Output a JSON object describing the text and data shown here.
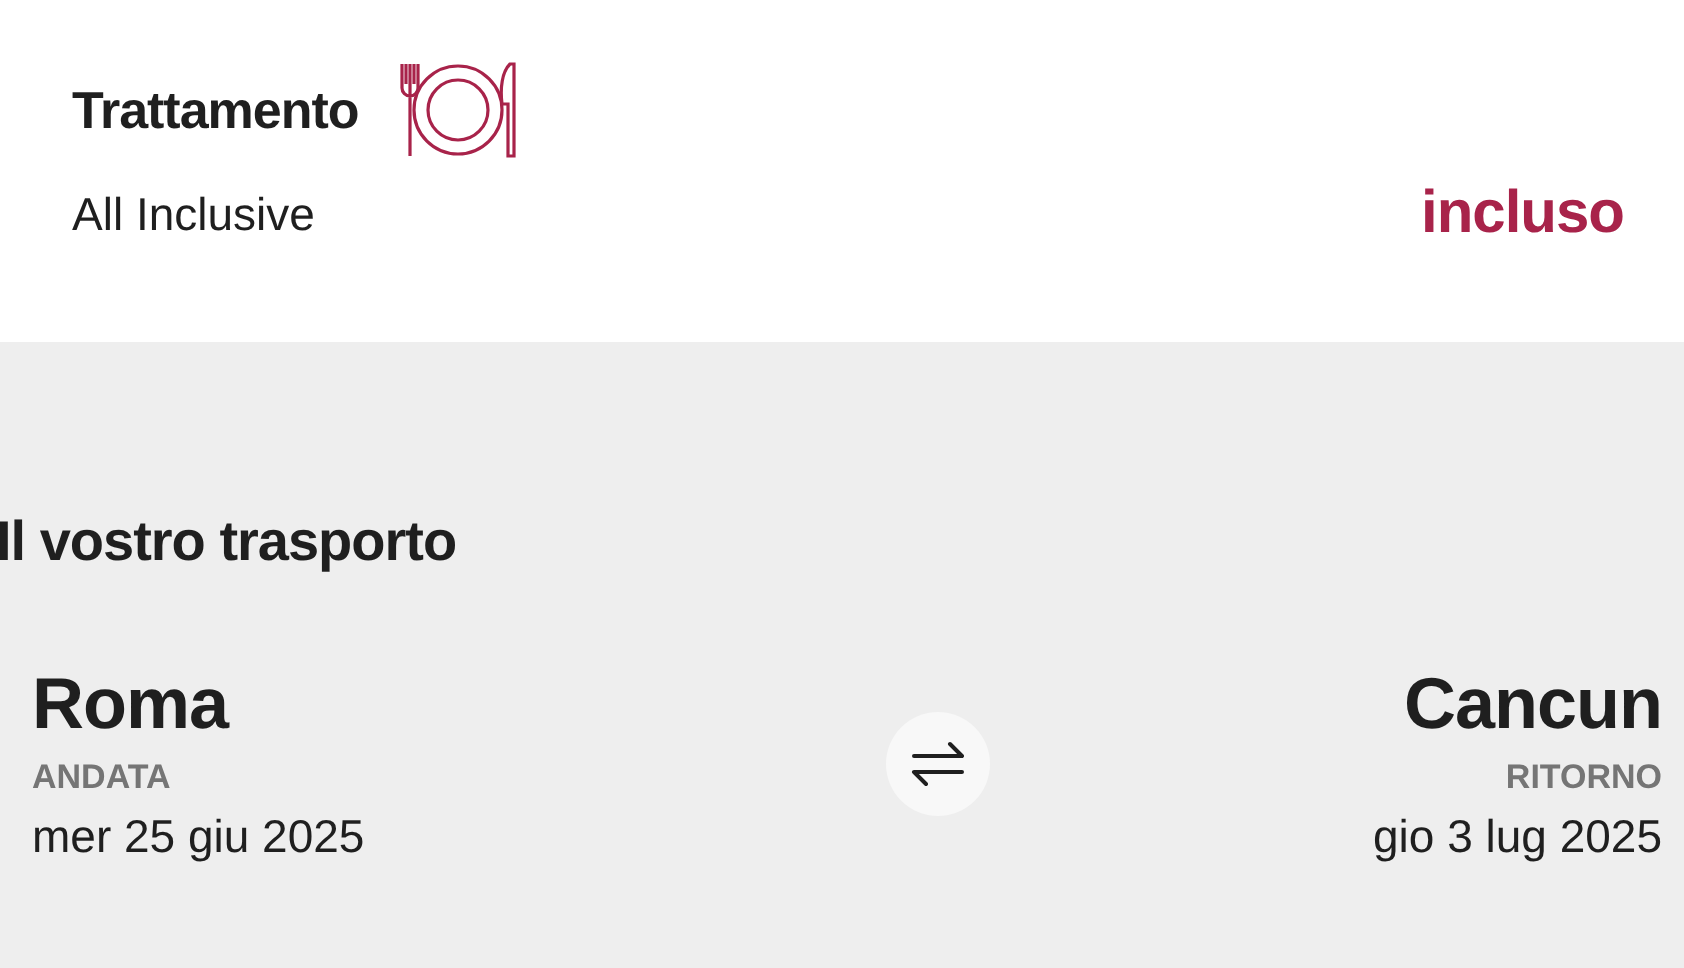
{
  "board": {
    "title": "Trattamento",
    "value": "All Inclusive",
    "price": "incluso"
  },
  "transport": {
    "title": "Il vostro trasporto",
    "legs": [
      {
        "city": "Roma",
        "label": "ANDATA",
        "date": "mer 25 giu 2025"
      },
      {
        "city": "Cancun",
        "label": "RITORNO",
        "date": "gio 3 lug 2025"
      }
    ]
  }
}
